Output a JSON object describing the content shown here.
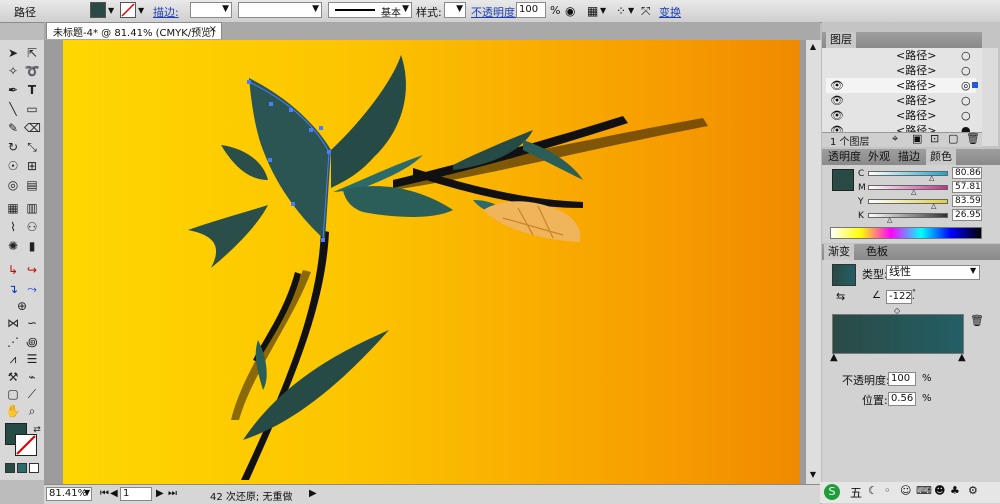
{
  "control_bar": {
    "object_type": "路径",
    "stroke_label": "描边:",
    "stroke_profile": "基本",
    "style_label": "样式:",
    "opacity_label": "不透明度:",
    "opacity_value": "100",
    "opacity_unit": "%",
    "transform_label": "变换"
  },
  "document": {
    "tab_title": "未标题-4* @ 81.41% (CMYK/预览)",
    "tab_close": "×"
  },
  "status_bar": {
    "zoom": "81.41%",
    "page": "1",
    "message": "42 次还原; 无重做"
  },
  "layers_panel": {
    "title": "图层",
    "rows": [
      "<路径>",
      "<路径>",
      "<路径>",
      "<路径>",
      "<路径>",
      "<路径>"
    ],
    "footer": "1 个图层"
  },
  "color_panel": {
    "tabs": [
      "透明度",
      "外观",
      "描边",
      "颜色"
    ],
    "active_tab": "颜色",
    "channels": [
      {
        "label": "C",
        "value": "80.86",
        "level": 0.8086,
        "color": "#1aa6c8"
      },
      {
        "label": "M",
        "value": "57.81",
        "level": 0.5781,
        "color": "#c4308a"
      },
      {
        "label": "Y",
        "value": "83.59",
        "level": 0.8359,
        "color": "#e0d040"
      },
      {
        "label": "K",
        "value": "26.95",
        "level": 0.2695,
        "color": "#333333"
      }
    ],
    "fill_color": "#2a4a45"
  },
  "gradient_panel": {
    "tabs": [
      "渐变",
      "色板"
    ],
    "active_tab": "渐变",
    "type_label": "类型:",
    "type_value": "线性",
    "angle_value": "-122.",
    "opacity_label": "不透明度:",
    "opacity_value": "100",
    "opacity_unit": "%",
    "location_label": "位置:",
    "location_value": "0.56",
    "location_unit": "%",
    "start_color": "#2a4a45",
    "end_color": "#235f66"
  },
  "taskbar": {
    "ime_label": "五"
  },
  "colors": {
    "accent_link": "#1f3fb0",
    "leaf_dark": "#264b47",
    "leaf_teal": "#2b6b6a",
    "bud_orange": "#f0b45a"
  }
}
